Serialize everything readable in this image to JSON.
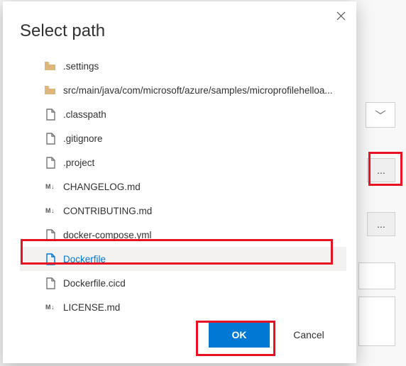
{
  "dialog": {
    "title": "Select path",
    "ok_label": "OK",
    "cancel_label": "Cancel"
  },
  "tree": {
    "items": [
      {
        "icon": "folder",
        "label": ".settings",
        "selected": false
      },
      {
        "icon": "folder",
        "label": "src/main/java/com/microsoft/azure/samples/microprofilehelloa...",
        "selected": false
      },
      {
        "icon": "file",
        "label": ".classpath",
        "selected": false
      },
      {
        "icon": "file",
        "label": ".gitignore",
        "selected": false
      },
      {
        "icon": "file",
        "label": ".project",
        "selected": false
      },
      {
        "icon": "md",
        "label": "CHANGELOG.md",
        "selected": false
      },
      {
        "icon": "md",
        "label": "CONTRIBUTING.md",
        "selected": false
      },
      {
        "icon": "file",
        "label": "docker-compose.yml",
        "selected": false
      },
      {
        "icon": "file",
        "label": "Dockerfile",
        "selected": true
      },
      {
        "icon": "file",
        "label": "Dockerfile.cicd",
        "selected": false
      },
      {
        "icon": "md",
        "label": "LICENSE.md",
        "selected": false
      }
    ]
  },
  "background": {
    "dots": "..."
  }
}
